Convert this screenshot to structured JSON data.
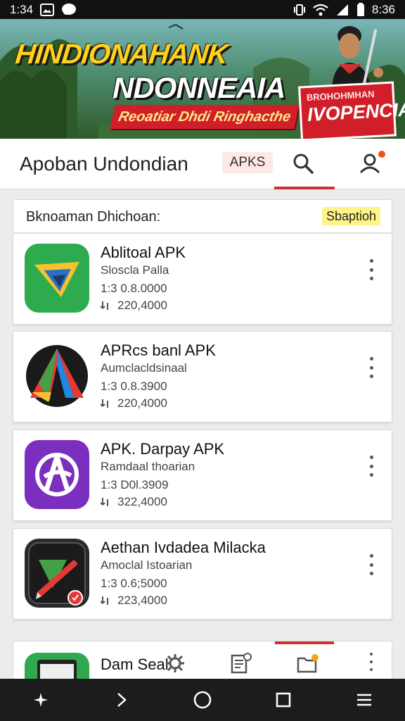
{
  "status_bar": {
    "time_left": "1:34",
    "time_right": "8:36"
  },
  "banner": {
    "title_line1": "HINDIONAHANK",
    "title_line2": "NDONNEAIA",
    "ribbon": "Reoatiar Dhdi Ringhacthe",
    "badge_line1": "BROHOHMHAN",
    "badge_line2": "IVOPENCIA"
  },
  "app_bar": {
    "title": "Apoban Undondian",
    "chip": "APKS"
  },
  "section": {
    "label": "Bknoaman Dhichoan:",
    "chip": "Sbaptioh"
  },
  "apps": [
    {
      "name": "Ablitoal APK",
      "developer": "Sloscla Palla",
      "version": "1:3 0.8.0000",
      "downloads": "220,4000"
    },
    {
      "name": "APRcs banl APK",
      "developer": "Aumclacldsinaal",
      "version": "1:3 0.8.3900",
      "downloads": "220,4000"
    },
    {
      "name": "APK. Darpay APK",
      "developer": "Ramdaal thoarian",
      "version": "1:3 D0l.3909",
      "downloads": "322,4000"
    },
    {
      "name": "Aethan Ivdadea Milacka",
      "developer": "Amoclal Istoarian",
      "version": "1:3 0.6;5000",
      "downloads": "223,4000"
    }
  ],
  "peek_app": {
    "name": "Dam Seal"
  },
  "colors": {
    "accent": "#d32f2f",
    "chip_yellow": "#fff48a"
  },
  "icons": [
    "sim-icon",
    "gallery-icon",
    "chat-icon",
    "vibrate-icon",
    "wifi-icon",
    "signal-icon",
    "battery-icon",
    "search-icon",
    "account-icon",
    "download-icon",
    "more-icon",
    "sparkle-icon",
    "back-icon",
    "home-icon",
    "recents-icon",
    "menu-icon"
  ]
}
